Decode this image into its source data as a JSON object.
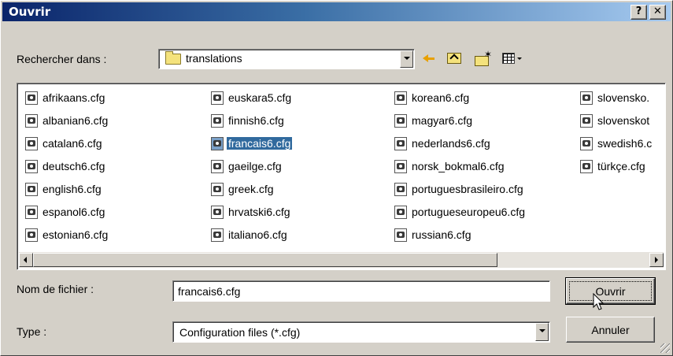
{
  "window": {
    "title": "Ouvrir",
    "help_label": "?",
    "close_label": "✕"
  },
  "lookin": {
    "label": "Rechercher dans :",
    "value": "translations",
    "icons": [
      "back-arrow-icon",
      "up-folder-icon",
      "new-folder-icon",
      "views-menu-icon"
    ]
  },
  "files": {
    "columns": [
      [
        "afrikaans.cfg",
        "albanian6.cfg",
        "catalan6.cfg",
        "deutsch6.cfg",
        "english6.cfg",
        "espanol6.cfg",
        "estonian6.cfg"
      ],
      [
        "euskara5.cfg",
        "finnish6.cfg",
        "francais6.cfg",
        "gaeilge.cfg",
        "greek.cfg",
        "hrvatski6.cfg",
        "italiano6.cfg"
      ],
      [
        "korean6.cfg",
        "magyar6.cfg",
        "nederlands6.cfg",
        "norsk_bokmal6.cfg",
        "portuguesbrasileiro.cfg",
        "portugueseuropeu6.cfg",
        "russian6.cfg"
      ],
      [
        "slovensko.",
        "slovenskot",
        "swedish6.c",
        "türkçe.cfg"
      ]
    ],
    "selected": "francais6.cfg"
  },
  "filename": {
    "label": "Nom de fichier :",
    "value": "francais6.cfg"
  },
  "filetype": {
    "label": "Type :",
    "value": "Configuration files (*.cfg)"
  },
  "buttons": {
    "open_label": "Ouvrir",
    "cancel_label": "Annuler"
  },
  "colors": {
    "selection": "#316a9e",
    "titlebar_start": "#0a246a",
    "titlebar_end": "#a6caf0",
    "face": "#d4d0c8"
  }
}
